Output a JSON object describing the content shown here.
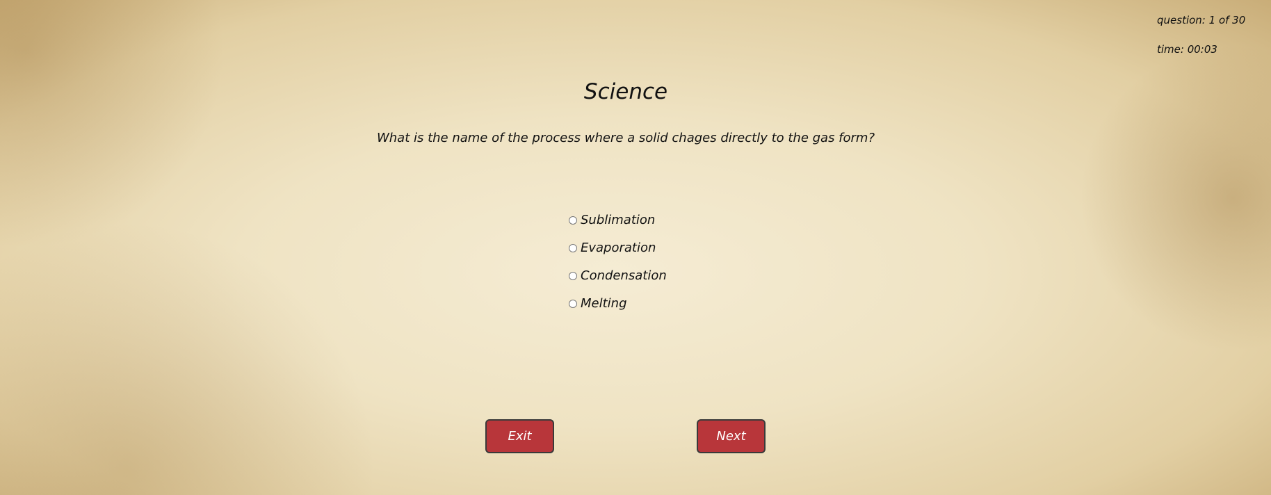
{
  "status": {
    "question": "question: 1 of 30",
    "time": "time: 00:03"
  },
  "quiz": {
    "category": "Science",
    "question": "What is the name of the process where a solid chages directly to the gas form?",
    "options": [
      "Sublimation",
      "Evaporation",
      "Condensation",
      "Melting"
    ]
  },
  "buttons": {
    "exit": "Exit",
    "next": "Next"
  }
}
